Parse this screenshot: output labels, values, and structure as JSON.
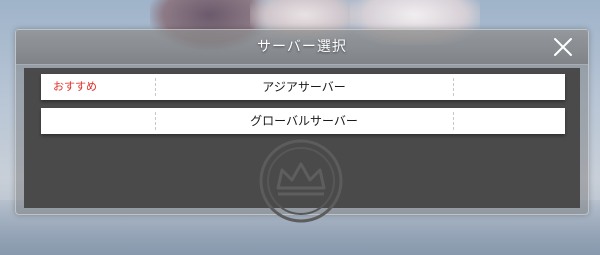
{
  "dialog": {
    "title": "サーバー選択",
    "close_icon": "close-icon"
  },
  "servers": [
    {
      "tag": "おすすめ",
      "name": "アジアサーバー",
      "status": ""
    },
    {
      "tag": "",
      "name": "グローバルサーバー",
      "status": ""
    }
  ],
  "colors": {
    "recommend_tag": "#e0302a",
    "row_background": "#ffffff",
    "body_background": "#4a4a4a"
  },
  "icons": {
    "emblem": "crown-emblem-icon"
  }
}
